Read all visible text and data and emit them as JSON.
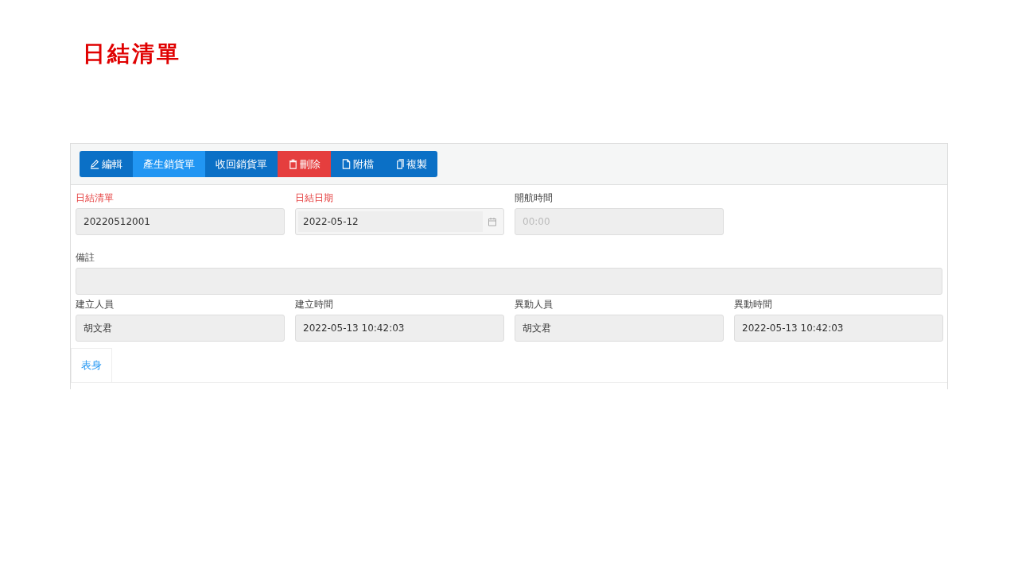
{
  "page_title": "日結清單",
  "toolbar": {
    "buttons": [
      {
        "label": "編輯",
        "kind": "edit"
      },
      {
        "label": "產生銷貨單",
        "kind": "generate"
      },
      {
        "label": "收回銷貨單",
        "kind": "recall"
      },
      {
        "label": "刪除",
        "kind": "delete"
      },
      {
        "label": "附檔",
        "kind": "attach"
      },
      {
        "label": "複製",
        "kind": "copy"
      }
    ]
  },
  "form_rows": [
    [
      {
        "label": "日結清單",
        "required": true,
        "kind": "text",
        "value": "20220512001"
      },
      {
        "label": "日結日期",
        "required": true,
        "kind": "date",
        "value": "2022-05-12"
      },
      {
        "label": "開航時間",
        "required": false,
        "kind": "text",
        "placeholder": "00:00"
      }
    ],
    [
      {
        "label": "備註",
        "required": false,
        "kind": "wide"
      }
    ],
    [
      {
        "label": "建立人員",
        "required": false,
        "kind": "text",
        "value": "胡文君"
      },
      {
        "label": "建立時間",
        "required": false,
        "kind": "text",
        "value": "2022-05-13 10:42:03"
      },
      {
        "label": "異動人員",
        "required": false,
        "kind": "text",
        "value": "胡文君"
      },
      {
        "label": "異動時間",
        "required": false,
        "kind": "text",
        "value": "2022-05-13 10:42:03"
      }
    ]
  ],
  "tabs": [
    {
      "label": "表身",
      "selected": true
    }
  ]
}
